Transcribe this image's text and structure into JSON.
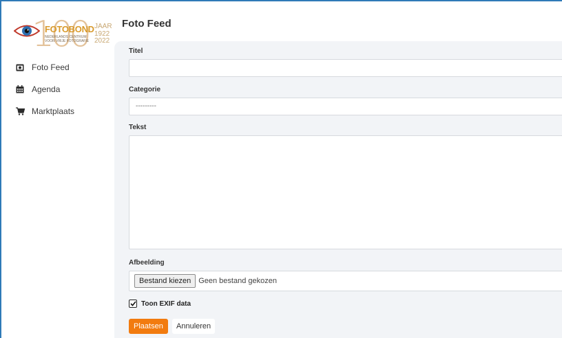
{
  "logo": {
    "number": "100",
    "brand": "FOTOBOND",
    "subtitle": "NEDERLANDS CENTRUM VOOR VRIJE FOTOGRAFIE",
    "jaar": "JAAR",
    "years": "1922 2022"
  },
  "sidebar": {
    "items": [
      {
        "label": "Foto Feed",
        "icon": "camera-icon"
      },
      {
        "label": "Agenda",
        "icon": "calendar-icon"
      },
      {
        "label": "Marktplaats",
        "icon": "cart-icon"
      }
    ]
  },
  "header": {
    "title": "Foto Feed"
  },
  "form": {
    "title_label": "Titel",
    "title_value": "",
    "category_label": "Categorie",
    "category_selected": "---------",
    "text_label": "Tekst",
    "text_value": "",
    "image_label": "Afbeelding",
    "file_button": "Bestand kiezen",
    "file_status": "Geen bestand gekozen",
    "exif_label": "Toon EXIF data",
    "exif_checked": true,
    "submit_label": "Plaatsen",
    "cancel_label": "Annuleren"
  },
  "colors": {
    "accent": "#f27b0f",
    "frame": "#2f7ab8",
    "content_bg": "#f2f4f7"
  }
}
